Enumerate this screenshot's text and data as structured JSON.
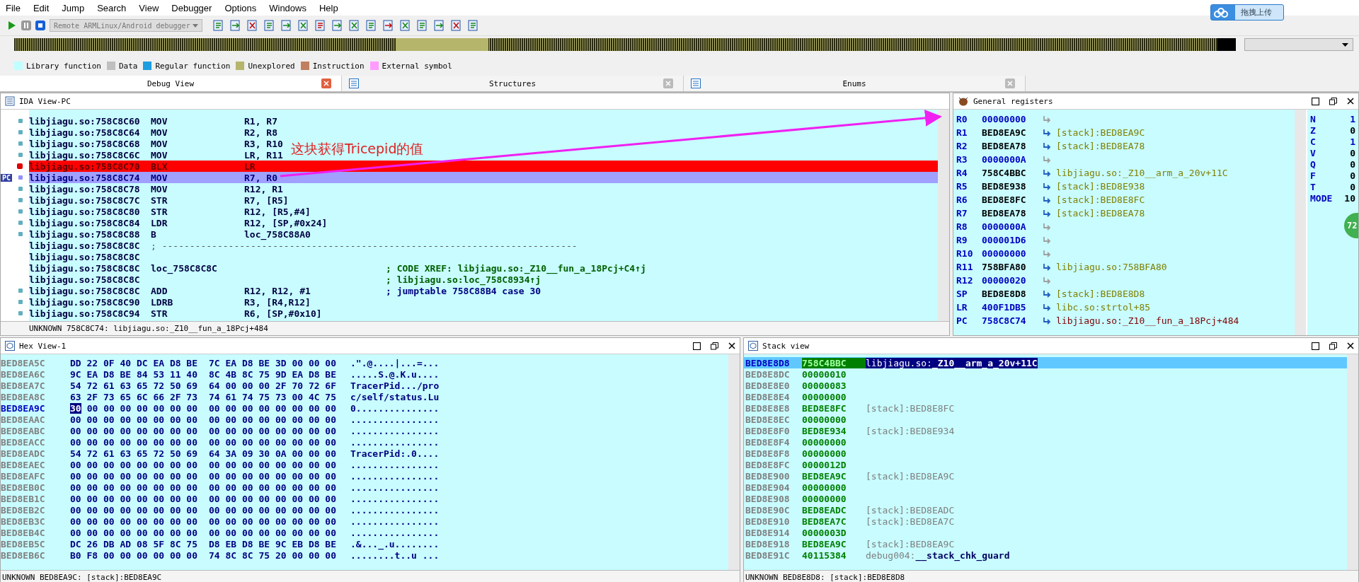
{
  "menu": [
    "File",
    "Edit",
    "Jump",
    "Search",
    "View",
    "Debugger",
    "Options",
    "Windows",
    "Help"
  ],
  "toolbar": {
    "debugger": "Remote ARMLinux/Android debugger"
  },
  "upload_button": "拖拽上传",
  "legend": [
    {
      "label": "Library function",
      "color": "#c0ffff"
    },
    {
      "label": "Data",
      "color": "#c0c0c0"
    },
    {
      "label": "Regular function",
      "color": "#1e9ee0"
    },
    {
      "label": "Unexplored",
      "color": "#b5b56c"
    },
    {
      "label": "Instruction",
      "color": "#c08060"
    },
    {
      "label": "External symbol",
      "color": "#ff9cff"
    }
  ],
  "tabs": [
    {
      "label": "Debug View",
      "selected": true
    },
    {
      "label": "Structures",
      "selected": false
    },
    {
      "label": "Enums",
      "selected": false
    }
  ],
  "ida_view": {
    "title": "IDA View-PC",
    "pc_label": "PC",
    "annotation": "这块获得Tricepid的值",
    "status": "UNKNOWN 758C8C74: libjiagu.so:_Z10__fun_a_18Pcj+484",
    "lines": [
      {
        "kind": "normal",
        "addr": "libjiagu.so:758C8C60",
        "mnem": "MOV",
        "ops": "R1, R7"
      },
      {
        "kind": "normal",
        "addr": "libjiagu.so:758C8C64",
        "mnem": "MOV",
        "ops": "R2, R8"
      },
      {
        "kind": "normal",
        "addr": "libjiagu.so:758C8C68",
        "mnem": "MOV",
        "ops": "R3, R10"
      },
      {
        "kind": "normal",
        "addr": "libjiagu.so:758C8C6C",
        "mnem": "MOV",
        "ops": "LR, R11"
      },
      {
        "kind": "breakpoint",
        "addr": "libjiagu.so:758C8C70",
        "mnem": "BLX",
        "ops": "LR"
      },
      {
        "kind": "current",
        "addr": "libjiagu.so:758C8C74",
        "mnem": "MOV",
        "ops": "R7, R0"
      },
      {
        "kind": "normal",
        "addr": "libjiagu.so:758C8C78",
        "mnem": "MOV",
        "ops": "R12, R1"
      },
      {
        "kind": "normal",
        "addr": "libjiagu.so:758C8C7C",
        "mnem": "STR",
        "ops": "R7, [R5]"
      },
      {
        "kind": "normal",
        "addr": "libjiagu.so:758C8C80",
        "mnem": "STR",
        "ops": "R12, [R5,#4]"
      },
      {
        "kind": "normal",
        "addr": "libjiagu.so:758C8C84",
        "mnem": "LDR",
        "ops": "R12, [SP,#0x24]"
      },
      {
        "kind": "normal",
        "addr": "libjiagu.so:758C8C88",
        "mnem": "B",
        "ops": "loc_758C88A0"
      },
      {
        "kind": "separator",
        "addr": "libjiagu.so:758C8C8C",
        "mnem": "; ---------------------------------------------------------------------------"
      },
      {
        "kind": "blank",
        "addr": "libjiagu.so:758C8C8C"
      },
      {
        "kind": "label",
        "addr": "libjiagu.so:758C8C8C",
        "mnem": "loc_758C8C8C",
        "comment": "; CODE XREF: libjiagu.so:_Z10__fun_a_18Pcj+C4↑j"
      },
      {
        "kind": "blank",
        "addr": "libjiagu.so:758C8C8C",
        "comment": "; libjiagu.so:loc_758C8934↑j"
      },
      {
        "kind": "normal",
        "addr": "libjiagu.so:758C8C8C",
        "mnem": "ADD",
        "ops": "R12, R12, #1",
        "comment": "; jumptable 758C88B4 case 30"
      },
      {
        "kind": "normal",
        "addr": "libjiagu.so:758C8C90",
        "mnem": "LDRB",
        "ops": "R3, [R4,R12]"
      },
      {
        "kind": "normal",
        "addr": "libjiagu.so:758C8C94",
        "mnem": "STR",
        "ops": "R6, [SP,#0x10]"
      }
    ]
  },
  "registers": {
    "title": "General registers",
    "badge": "72",
    "rows": [
      {
        "name": "R0",
        "value": "00000000",
        "kind": "data"
      },
      {
        "name": "R1",
        "value": "BED8EA9C",
        "kind": "stack",
        "target": "[stack]:BED8EA9C"
      },
      {
        "name": "R2",
        "value": "BED8EA78",
        "kind": "stack",
        "target": "[stack]:BED8EA78"
      },
      {
        "name": "R3",
        "value": "0000000A",
        "kind": "data"
      },
      {
        "name": "R4",
        "value": "758C4BBC",
        "kind": "code",
        "target": "libjiagu.so:_Z10__arm_a_20v+11C"
      },
      {
        "name": "R5",
        "value": "BED8E938",
        "kind": "stack",
        "target": "[stack]:BED8E938"
      },
      {
        "name": "R6",
        "value": "BED8E8FC",
        "kind": "stack",
        "target": "[stack]:BED8E8FC"
      },
      {
        "name": "R7",
        "value": "BED8EA78",
        "kind": "stack",
        "target": "[stack]:BED8EA78"
      },
      {
        "name": "R8",
        "value": "0000000A",
        "kind": "data"
      },
      {
        "name": "R9",
        "value": "000001D6",
        "kind": "data"
      },
      {
        "name": "R10",
        "value": "00000000",
        "kind": "data"
      },
      {
        "name": "R11",
        "value": "758BFA80",
        "kind": "code",
        "target": "libjiagu.so:758BFA80"
      },
      {
        "name": "R12",
        "value": "00000020",
        "kind": "data"
      },
      {
        "name": "SP",
        "value": "BED8E8D8",
        "kind": "stack",
        "target": "[stack]:BED8E8D8"
      },
      {
        "name": "LR",
        "value": "400F1DB5",
        "kind": "lib",
        "target": "libc.so:strtol+85"
      },
      {
        "name": "PC",
        "value": "758C8C74",
        "kind": "pc",
        "target": "libjiagu.so:_Z10__fun_a_18Pcj+484"
      }
    ],
    "flags": [
      {
        "name": "N",
        "value": "1",
        "set": true
      },
      {
        "name": "Z",
        "value": "0",
        "set": false
      },
      {
        "name": "C",
        "value": "1",
        "set": true
      },
      {
        "name": "V",
        "value": "0",
        "set": false
      },
      {
        "name": "Q",
        "value": "0",
        "set": false
      },
      {
        "name": "F",
        "value": "0",
        "set": false
      },
      {
        "name": "T",
        "value": "0",
        "set": false
      },
      {
        "name": "MODE",
        "value": "10",
        "set": false
      }
    ]
  },
  "hex_view": {
    "title": "Hex View-1",
    "status": "UNKNOWN BED8EA9C: [stack]:BED8EA9C",
    "rows": [
      {
        "addr": "BED8EA5C",
        "bytes1": "DD 22 0F 40 DC EA D8 BE",
        "bytes2": "7C EA D8 BE 3D 00 00 00",
        "ascii": ".\".@....|...=...",
        "selected": false
      },
      {
        "addr": "BED8EA6C",
        "bytes1": "9C EA D8 BE 84 53 11 40",
        "bytes2": "8C 4B 8C 75 9D EA D8 BE",
        "ascii": ".....S.@.K.u....",
        "selected": false
      },
      {
        "addr": "BED8EA7C",
        "bytes1": "54 72 61 63 65 72 50 69",
        "bytes2": "64 00 00 00 2F 70 72 6F",
        "ascii": "TracerPid.../pro",
        "selected": false
      },
      {
        "addr": "BED8EA8C",
        "bytes1": "63 2F 73 65 6C 66 2F 73",
        "bytes2": "74 61 74 75 73 00 4C 75",
        "ascii": "c/self/status.Lu",
        "selected": false
      },
      {
        "addr": "BED8EA9C",
        "cursor": "30",
        "bytes1": "00 00 00 00 00 00 00",
        "bytes2": "00 00 00 00 00 00 00 00",
        "ascii": "0...............",
        "selected": true
      },
      {
        "addr": "BED8EAAC",
        "bytes1": "00 00 00 00 00 00 00 00",
        "bytes2": "00 00 00 00 00 00 00 00",
        "ascii": "................",
        "selected": false
      },
      {
        "addr": "BED8EABC",
        "bytes1": "00 00 00 00 00 00 00 00",
        "bytes2": "00 00 00 00 00 00 00 00",
        "ascii": "................",
        "selected": false
      },
      {
        "addr": "BED8EACC",
        "bytes1": "00 00 00 00 00 00 00 00",
        "bytes2": "00 00 00 00 00 00 00 00",
        "ascii": "................",
        "selected": false
      },
      {
        "addr": "BED8EADC",
        "bytes1": "54 72 61 63 65 72 50 69",
        "bytes2": "64 3A 09 30 0A 00 00 00",
        "ascii": "TracerPid:.0....",
        "selected": false
      },
      {
        "addr": "BED8EAEC",
        "bytes1": "00 00 00 00 00 00 00 00",
        "bytes2": "00 00 00 00 00 00 00 00",
        "ascii": "................",
        "selected": false
      },
      {
        "addr": "BED8EAFC",
        "bytes1": "00 00 00 00 00 00 00 00",
        "bytes2": "00 00 00 00 00 00 00 00",
        "ascii": "................",
        "selected": false
      },
      {
        "addr": "BED8EB0C",
        "bytes1": "00 00 00 00 00 00 00 00",
        "bytes2": "00 00 00 00 00 00 00 00",
        "ascii": "................",
        "selected": false
      },
      {
        "addr": "BED8EB1C",
        "bytes1": "00 00 00 00 00 00 00 00",
        "bytes2": "00 00 00 00 00 00 00 00",
        "ascii": "................",
        "selected": false
      },
      {
        "addr": "BED8EB2C",
        "bytes1": "00 00 00 00 00 00 00 00",
        "bytes2": "00 00 00 00 00 00 00 00",
        "ascii": "................",
        "selected": false
      },
      {
        "addr": "BED8EB3C",
        "bytes1": "00 00 00 00 00 00 00 00",
        "bytes2": "00 00 00 00 00 00 00 00",
        "ascii": "................",
        "selected": false
      },
      {
        "addr": "BED8EB4C",
        "bytes1": "00 00 00 00 00 00 00 00",
        "bytes2": "00 00 00 00 00 00 00 00",
        "ascii": "................",
        "selected": false
      },
      {
        "addr": "BED8EB5C",
        "bytes1": "DC 26 DB AD 08 5F 8C 75",
        "bytes2": "D8 EB D8 BE 9C EB D8 BE",
        "ascii": ".&..._.u........",
        "selected": false
      },
      {
        "addr": "BED8EB6C",
        "bytes1": "B0 F8 00 00 00 00 00 00",
        "bytes2": "74 8C 8C 75 20 00 00 00",
        "ascii": "........t..u ...",
        "selected": false
      }
    ]
  },
  "stack_view": {
    "title": "Stack view",
    "status": "UNKNOWN BED8E8D8: [stack]:BED8E8D8",
    "rows": [
      {
        "addr": "BED8E8D8",
        "value": "758C4BBC",
        "target_prefix": "libjiagu.so:",
        "target_name": "_Z10__arm_a_20v+11C",
        "selected": true
      },
      {
        "addr": "BED8E8DC",
        "value": "00000010",
        "selected": false
      },
      {
        "addr": "BED8E8E0",
        "value": "00000083",
        "selected": false
      },
      {
        "addr": "BED8E8E4",
        "value": "00000000",
        "selected": false
      },
      {
        "addr": "BED8E8E8",
        "value": "BED8E8FC",
        "target_prefix": "[stack]:BED8E8FC",
        "selected": false
      },
      {
        "addr": "BED8E8EC",
        "value": "00000000",
        "selected": false
      },
      {
        "addr": "BED8E8F0",
        "value": "BED8E934",
        "target_prefix": "[stack]:BED8E934",
        "selected": false
      },
      {
        "addr": "BED8E8F4",
        "value": "00000000",
        "selected": false
      },
      {
        "addr": "BED8E8F8",
        "value": "00000000",
        "selected": false
      },
      {
        "addr": "BED8E8FC",
        "value": "0000012D",
        "selected": false
      },
      {
        "addr": "BED8E900",
        "value": "BED8EA9C",
        "target_prefix": "[stack]:BED8EA9C",
        "selected": false
      },
      {
        "addr": "BED8E904",
        "value": "00000000",
        "selected": false
      },
      {
        "addr": "BED8E908",
        "value": "00000000",
        "selected": false
      },
      {
        "addr": "BED8E90C",
        "value": "BED8EADC",
        "target_prefix": "[stack]:BED8EADC",
        "selected": false
      },
      {
        "addr": "BED8E910",
        "value": "BED8EA7C",
        "target_prefix": "[stack]:BED8EA7C",
        "selected": false
      },
      {
        "addr": "BED8E914",
        "value": "0000003D",
        "selected": false
      },
      {
        "addr": "BED8E918",
        "value": "BED8EA9C",
        "target_prefix": "[stack]:BED8EA9C",
        "selected": false
      },
      {
        "addr": "BED8E91C",
        "value": "40115384",
        "target_prefix": "debug004:",
        "target_name": "__stack_chk_guard",
        "selected": false
      }
    ]
  }
}
